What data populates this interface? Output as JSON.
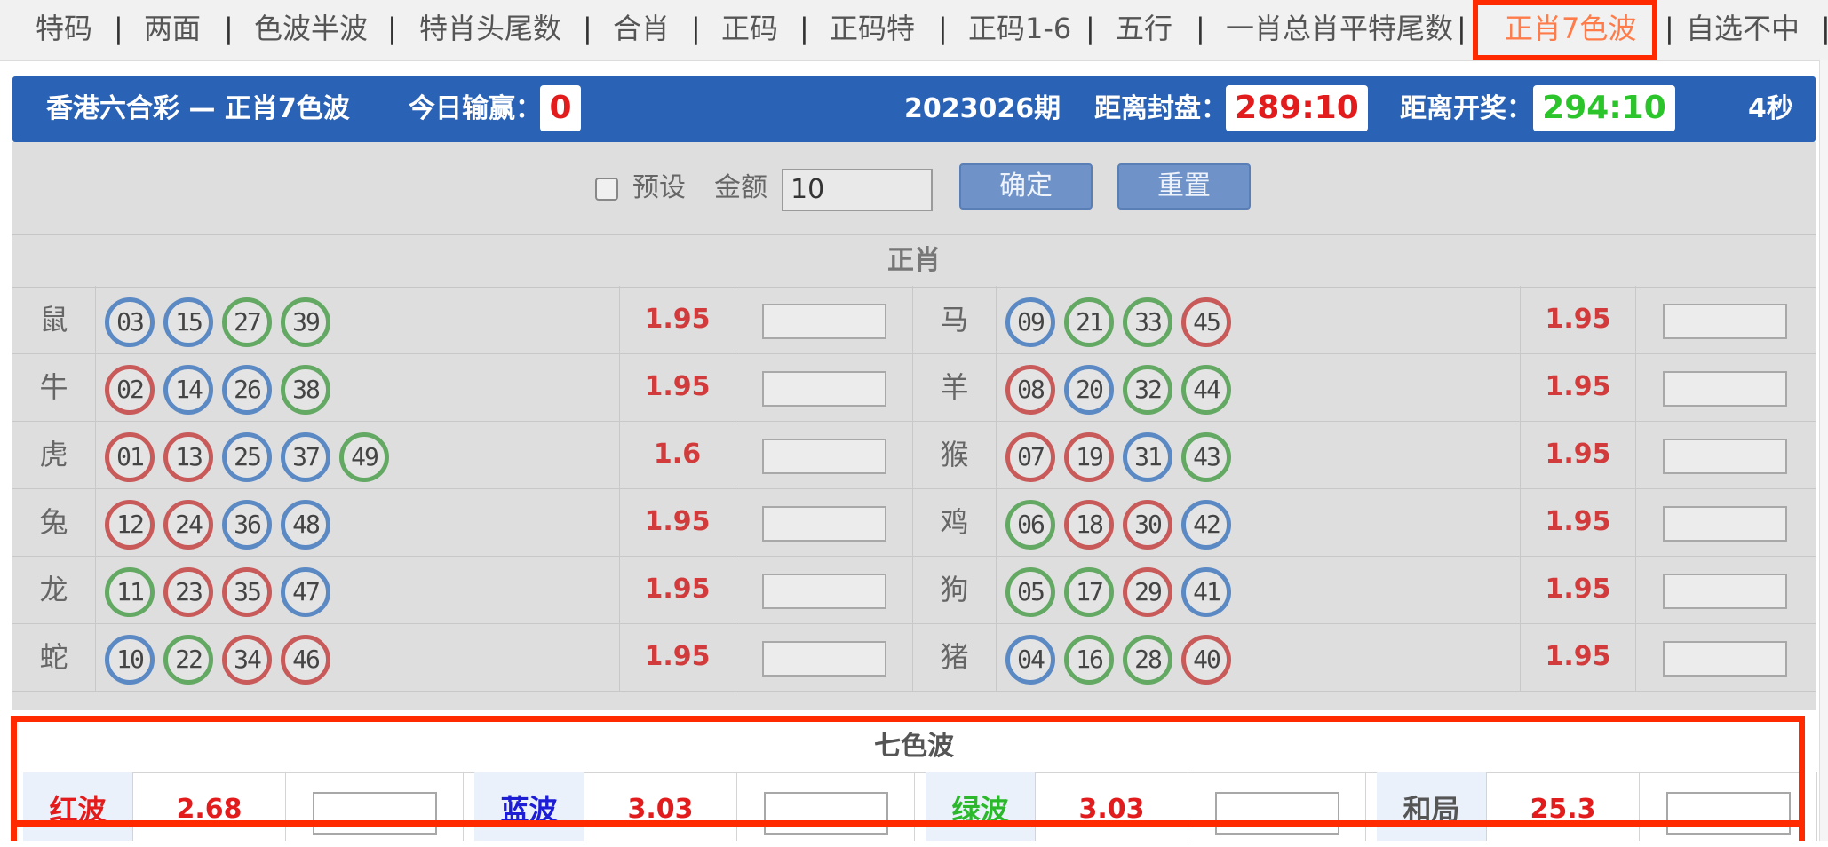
{
  "nav": {
    "items": [
      "特码",
      "两面",
      "色波半波",
      "特肖头尾数",
      "合肖",
      "正码",
      "正码特",
      "正码1-6",
      "五行",
      "一肖总肖平特尾数",
      "正肖7色波",
      "自选不中"
    ],
    "active_index": 10,
    "separator": "|",
    "active_color": "#ff7c4a"
  },
  "header": {
    "title": "香港六合彩 — 正肖7色波",
    "today_label": "今日输赢：",
    "today_value": "0",
    "period": "2023026期",
    "close_label": "距离封盘：",
    "close_value": "289:10",
    "draw_label": "距离开奖：",
    "draw_value": "294:10",
    "refresh": "4秒",
    "bar_color": "#2a62b6"
  },
  "preset": {
    "checkbox_label": "预设",
    "amount_label": "金额",
    "amount_value": "10",
    "confirm": "确定",
    "reset": "重置"
  },
  "zhengxiao": {
    "title": "正肖",
    "left": [
      {
        "zodiac": "鼠",
        "balls": [
          [
            "03",
            "blue"
          ],
          [
            "15",
            "blue"
          ],
          [
            "27",
            "green"
          ],
          [
            "39",
            "green"
          ]
        ],
        "odds": "1.95"
      },
      {
        "zodiac": "牛",
        "balls": [
          [
            "02",
            "red"
          ],
          [
            "14",
            "blue"
          ],
          [
            "26",
            "blue"
          ],
          [
            "38",
            "green"
          ]
        ],
        "odds": "1.95"
      },
      {
        "zodiac": "虎",
        "balls": [
          [
            "01",
            "red"
          ],
          [
            "13",
            "red"
          ],
          [
            "25",
            "blue"
          ],
          [
            "37",
            "blue"
          ],
          [
            "49",
            "green"
          ]
        ],
        "odds": "1.6"
      },
      {
        "zodiac": "兔",
        "balls": [
          [
            "12",
            "red"
          ],
          [
            "24",
            "red"
          ],
          [
            "36",
            "blue"
          ],
          [
            "48",
            "blue"
          ]
        ],
        "odds": "1.95"
      },
      {
        "zodiac": "龙",
        "balls": [
          [
            "11",
            "green"
          ],
          [
            "23",
            "red"
          ],
          [
            "35",
            "red"
          ],
          [
            "47",
            "blue"
          ]
        ],
        "odds": "1.95"
      },
      {
        "zodiac": "蛇",
        "balls": [
          [
            "10",
            "blue"
          ],
          [
            "22",
            "green"
          ],
          [
            "34",
            "red"
          ],
          [
            "46",
            "red"
          ]
        ],
        "odds": "1.95"
      }
    ],
    "right": [
      {
        "zodiac": "马",
        "balls": [
          [
            "09",
            "blue"
          ],
          [
            "21",
            "green"
          ],
          [
            "33",
            "green"
          ],
          [
            "45",
            "red"
          ]
        ],
        "odds": "1.95"
      },
      {
        "zodiac": "羊",
        "balls": [
          [
            "08",
            "red"
          ],
          [
            "20",
            "blue"
          ],
          [
            "32",
            "green"
          ],
          [
            "44",
            "green"
          ]
        ],
        "odds": "1.95"
      },
      {
        "zodiac": "猴",
        "balls": [
          [
            "07",
            "red"
          ],
          [
            "19",
            "red"
          ],
          [
            "31",
            "blue"
          ],
          [
            "43",
            "green"
          ]
        ],
        "odds": "1.95"
      },
      {
        "zodiac": "鸡",
        "balls": [
          [
            "06",
            "green"
          ],
          [
            "18",
            "red"
          ],
          [
            "30",
            "red"
          ],
          [
            "42",
            "blue"
          ]
        ],
        "odds": "1.95"
      },
      {
        "zodiac": "狗",
        "balls": [
          [
            "05",
            "green"
          ],
          [
            "17",
            "green"
          ],
          [
            "29",
            "red"
          ],
          [
            "41",
            "blue"
          ]
        ],
        "odds": "1.95"
      },
      {
        "zodiac": "猪",
        "balls": [
          [
            "04",
            "blue"
          ],
          [
            "16",
            "green"
          ],
          [
            "28",
            "green"
          ],
          [
            "40",
            "red"
          ]
        ],
        "odds": "1.95"
      }
    ]
  },
  "wave": {
    "title": "七色波",
    "items": [
      {
        "label": "红波",
        "odds": "2.68",
        "color": "#e21c1c"
      },
      {
        "label": "蓝波",
        "odds": "3.03",
        "color": "#1d1dd6"
      },
      {
        "label": "绿波",
        "odds": "3.03",
        "color": "#2bb82b"
      },
      {
        "label": "和局",
        "odds": "25.3",
        "color": "#555555"
      }
    ]
  }
}
